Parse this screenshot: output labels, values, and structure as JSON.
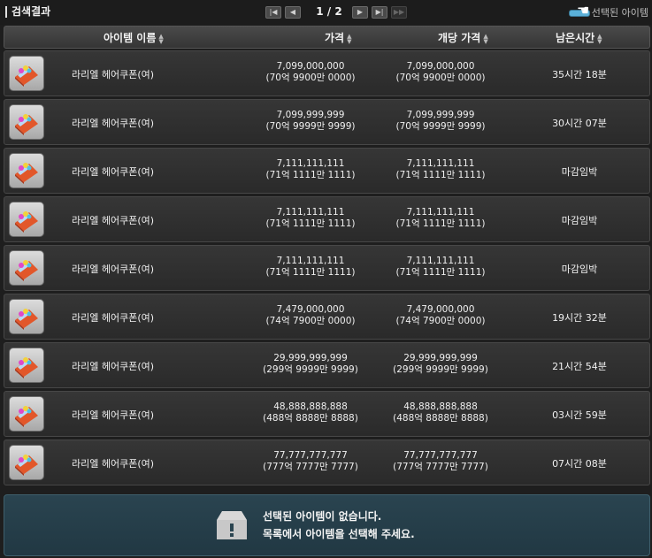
{
  "title": "검색결과",
  "pagination": {
    "page_label": "1 / 2"
  },
  "selected_filter_label": "선택된 아이템",
  "columns": [
    "아이템 이름",
    "가격",
    "개당 가격",
    "남은시간"
  ],
  "rows": [
    {
      "name": "라리엘 헤어쿠폰(여)",
      "price": "7,099,000,000",
      "price_kr": "(70억 9900만 0000)",
      "unit_price": "7,099,000,000",
      "unit_price_kr": "(70억 9900만 0000)",
      "remaining": "35시간 18분"
    },
    {
      "name": "라리엘 헤어쿠폰(여)",
      "price": "7,099,999,999",
      "price_kr": "(70억 9999만 9999)",
      "unit_price": "7,099,999,999",
      "unit_price_kr": "(70억 9999만 9999)",
      "remaining": "30시간 07분"
    },
    {
      "name": "라리엘 헤어쿠폰(여)",
      "price": "7,111,111,111",
      "price_kr": "(71억 1111만 1111)",
      "unit_price": "7,111,111,111",
      "unit_price_kr": "(71억 1111만 1111)",
      "remaining": "마감임박"
    },
    {
      "name": "라리엘 헤어쿠폰(여)",
      "price": "7,111,111,111",
      "price_kr": "(71억 1111만 1111)",
      "unit_price": "7,111,111,111",
      "unit_price_kr": "(71억 1111만 1111)",
      "remaining": "마감임박"
    },
    {
      "name": "라리엘 헤어쿠폰(여)",
      "price": "7,111,111,111",
      "price_kr": "(71억 1111만 1111)",
      "unit_price": "7,111,111,111",
      "unit_price_kr": "(71억 1111만 1111)",
      "remaining": "마감임박"
    },
    {
      "name": "라리엘 헤어쿠폰(여)",
      "price": "7,479,000,000",
      "price_kr": "(74억 7900만 0000)",
      "unit_price": "7,479,000,000",
      "unit_price_kr": "(74억 7900만 0000)",
      "remaining": "19시간 32분"
    },
    {
      "name": "라리엘 헤어쿠폰(여)",
      "price": "29,999,999,999",
      "price_kr": "(299억 9999만 9999)",
      "unit_price": "29,999,999,999",
      "unit_price_kr": "(299억 9999만 9999)",
      "remaining": "21시간 54분"
    },
    {
      "name": "라리엘 헤어쿠폰(여)",
      "price": "48,888,888,888",
      "price_kr": "(488억 8888만 8888)",
      "unit_price": "48,888,888,888",
      "unit_price_kr": "(488억 8888만 8888)",
      "remaining": "03시간 59분"
    },
    {
      "name": "라리엘 헤어쿠폰(여)",
      "price": "77,777,777,777",
      "price_kr": "(777억 7777만 7777)",
      "unit_price": "77,777,777,777",
      "unit_price_kr": "(777억 7777만 7777)",
      "remaining": "07시간 08분"
    }
  ],
  "empty_selection": {
    "line1": "선택된 아이템이 없습니다.",
    "line2": "목록에서 아이템을 선택해 주세요."
  }
}
